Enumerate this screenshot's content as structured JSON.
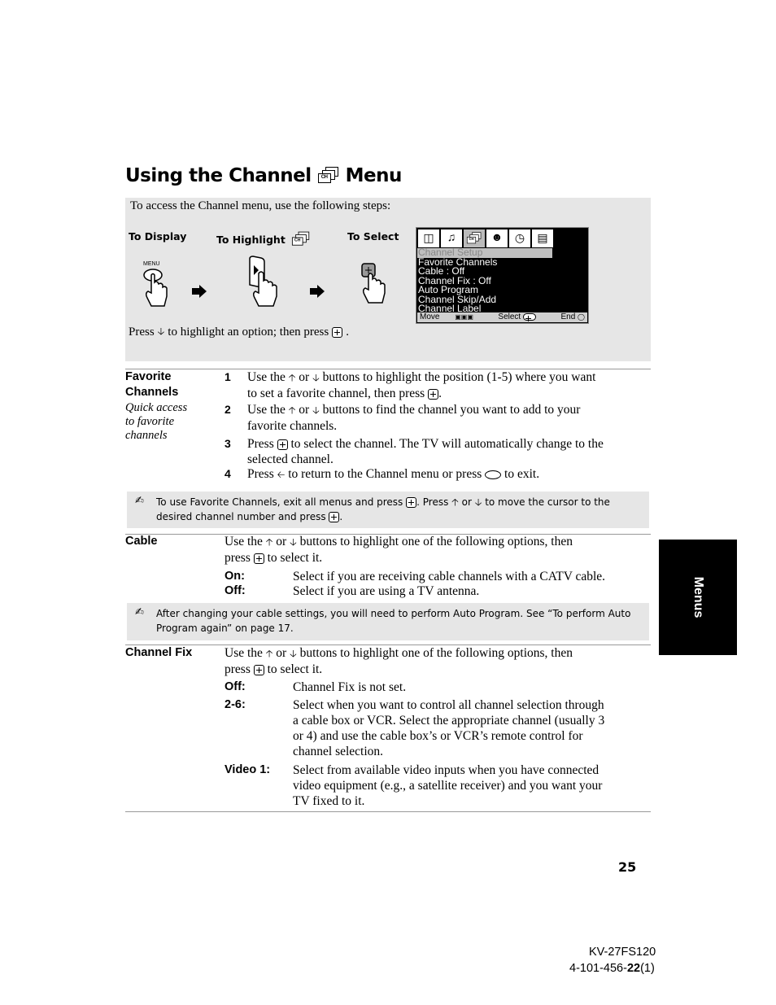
{
  "page": {
    "title_before_icon": "Using the Channel",
    "title_icon": "channel-menu-icon",
    "title_icon_text": "CH",
    "title_after_icon": "Menu",
    "page_number": "25",
    "model": "KV-27FS120",
    "doc_code_prefix": "4-101-456-",
    "doc_code_bold": "22",
    "doc_code_suffix": "(1)",
    "side_tab": "Menus"
  },
  "steps": {
    "intro": "To access the Channel menu, use the following steps:",
    "to_display": "To Display",
    "to_highlight": "To Highlight",
    "to_select": "To Select",
    "menu_key_label": "MENU",
    "press_prefix": "Press",
    "press_middle": "to highlight an option; then press",
    "press_suffix": "."
  },
  "osd": {
    "icons": [
      "picture-icon",
      "audio-icon",
      "channel-icon",
      "parent-icon",
      "timer-icon",
      "setup-icon"
    ],
    "selected_icon_index": 2,
    "items": [
      "Channel Setup",
      "Favorite Channels",
      "Cable : Off",
      "Channel Fix : Off",
      "Auto Program",
      "Channel Skip/Add",
      "Channel Label"
    ],
    "highlighted_index": 0,
    "footer_move": "Move",
    "footer_select": "Select",
    "footer_end": "End"
  },
  "sections": {
    "favorite": {
      "label_line1": "Favorite",
      "label_line2": "Channels",
      "subtitle_line1": "Quick access",
      "subtitle_line2": "to favorite",
      "subtitle_line3": "channels",
      "steps": [
        {
          "n": "1",
          "a": "Use the",
          "b": "or",
          "c": "buttons to highlight the position (1-5) where you want",
          "d": "to set a favorite channel, then press",
          "e": "."
        },
        {
          "n": "2",
          "a": "Use the",
          "b": "or",
          "c": "buttons to find the channel you want to add to your",
          "d": "favorite channels."
        },
        {
          "n": "3",
          "a": "Press",
          "c": "to select the channel. The TV will automatically change to the",
          "d": "selected channel."
        },
        {
          "n": "4",
          "a": "Press",
          "c": "to return to the Channel menu or press",
          "e": "to exit."
        }
      ],
      "note_line1_a": "To use Favorite Channels, exit all menus and press",
      "note_line1_b": ". Press",
      "note_line1_c": "or",
      "note_line1_d": "to move the cursor to the",
      "note_line2_a": "desired channel number and press",
      "note_line2_b": "."
    },
    "cable": {
      "label": "Cable",
      "intro_a": "Use the",
      "intro_b": "or",
      "intro_c": "buttons to highlight one of the following options, then",
      "intro_d": "press",
      "intro_e": "to select it.",
      "options": [
        {
          "key": "On:",
          "desc": "Select if you are receiving cable channels with a CATV cable."
        },
        {
          "key": "Off:",
          "desc": "Select if you are using a TV antenna."
        }
      ],
      "note_line1": "After changing your cable settings, you will need to perform Auto Program. See “To perform Auto",
      "note_line2": "Program again” on page 17."
    },
    "channel_fix": {
      "label": "Channel Fix",
      "intro_a": "Use the",
      "intro_b": "or",
      "intro_c": "buttons to highlight one of the following options, then",
      "intro_d": "press",
      "intro_e": "to select it.",
      "options": [
        {
          "key": "Off:",
          "lines": [
            "Channel Fix is not set."
          ]
        },
        {
          "key": "2-6:",
          "lines": [
            "Select when you want to control all channel selection through",
            "a cable box or VCR. Select the appropriate channel (usually 3",
            "or 4) and use the cable box’s or VCR’s remote control for",
            "channel selection."
          ]
        },
        {
          "key": "Video 1:",
          "lines": [
            "Select from available video inputs when you have connected",
            "video equipment (e.g., a satellite receiver) and you want your",
            "TV fixed to it."
          ]
        }
      ]
    }
  }
}
